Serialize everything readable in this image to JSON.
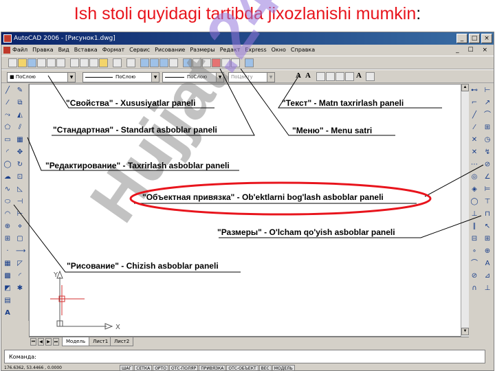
{
  "slide": {
    "title": "Ish stoli quyidagi tartibda jixozlanishi mumkin",
    "title_colon": ":",
    "title_color": "#e8141c"
  },
  "app": {
    "window_title": "AutoCAD 2006 - [Рисунок1.dwg]",
    "window_buttons": [
      "_",
      "□",
      "×"
    ],
    "menu": [
      "Файл",
      "Правка",
      "Вид",
      "Вставка",
      "Формат",
      "Сервис",
      "Рисование",
      "Размеры",
      "Редакт",
      "Express",
      "Окно",
      "Справка"
    ],
    "mdi_buttons": "_ ☐ ×",
    "properties": {
      "layer": "■ ПоСлою",
      "linetype": "ПоСлою",
      "lineweight": "ПоСлою",
      "color": "ПоЦвету"
    },
    "tabs": [
      "Модель",
      "Лист1",
      "Лист2"
    ],
    "active_tab": "Модель",
    "command_prompt": "Команда:",
    "coordinates": "176.6362, 53.4466 , 0.0000",
    "status_buttons": [
      "ШАГ",
      "СЕТКА",
      "ОРТО",
      "ОТС-ПОЛЯР",
      "ПРИВЯЗКА",
      "ОТС-ОБЪЕКТ",
      "ВЕС",
      "МОДЕЛЬ"
    ],
    "ucs": {
      "x_label": "X",
      "y_label": "Y"
    }
  },
  "callouts": {
    "properties": "\"Свойства\" - Xususiyatlar paneli",
    "text": "\"Текст\" - Matn taxrirlash paneli",
    "standard": "\"Стандартная\" - Standart asboblar  paneli",
    "menu": "\"Меню\" - Menu satri",
    "modify": "\"Редактирование\" - Taxrirlash asboblar paneli",
    "osnap": "\"Объектная привязка\" - Ob'ektlarni bog'lash asboblar paneli",
    "dimension": "\"Размеры\" - O'lcham qo'yish asboblar paneli",
    "draw": "\"Рисование\" - Chizish asboblar paneli"
  },
  "watermark": {
    "text": "Hujjat",
    "tail": ".24"
  },
  "colors": {
    "highlight_ellipse": "#e8141c",
    "titlebar": "#0a246a",
    "ucs_cursor": "#d32f2f"
  }
}
